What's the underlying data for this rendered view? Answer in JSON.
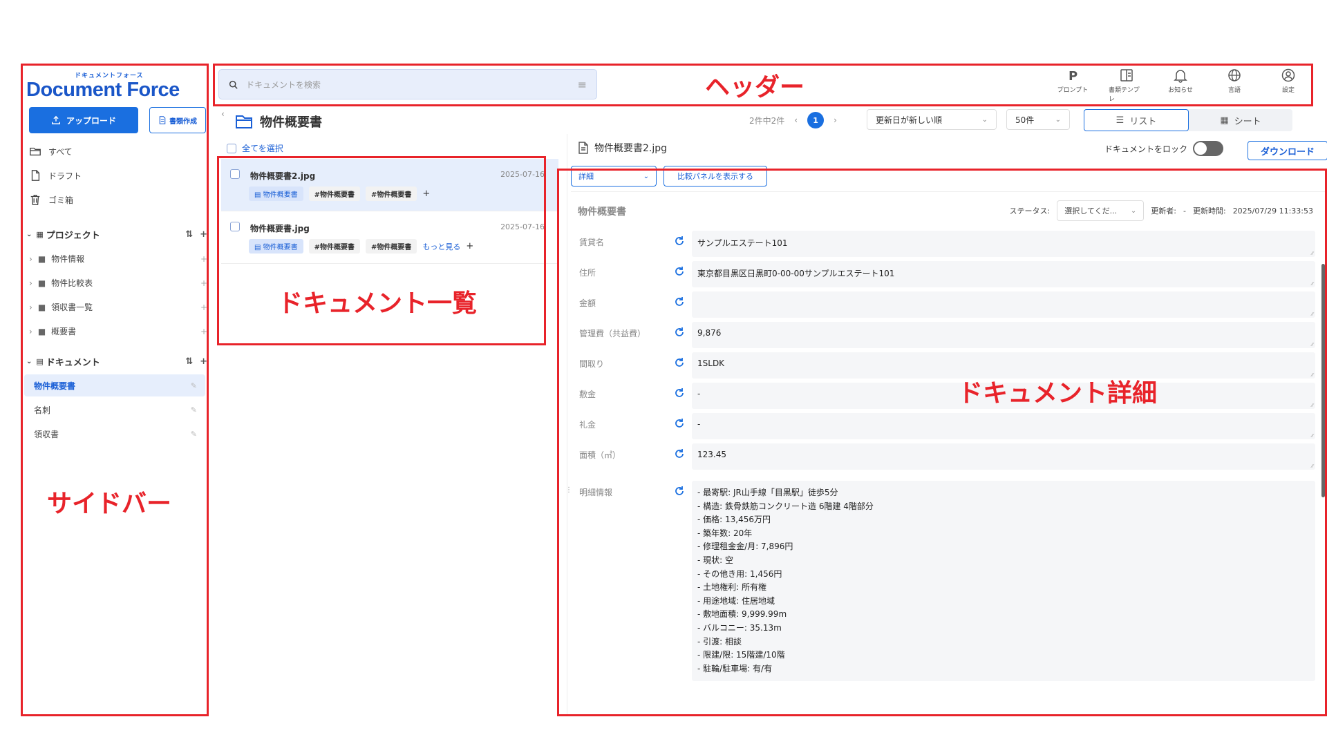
{
  "sidebar": {
    "logo_small": "ドキュメントフォース",
    "logo_main": "Document Force",
    "upload_label": "アップロード",
    "create_label": "書類作成",
    "nav": [
      {
        "label": "すべて",
        "icon": "folder-open-icon"
      },
      {
        "label": "ドラフト",
        "icon": "file-icon"
      },
      {
        "label": "ゴミ箱",
        "icon": "trash-icon"
      }
    ],
    "projects_header": "プロジェクト",
    "projects": [
      {
        "label": "物件情報"
      },
      {
        "label": "物件比較表"
      },
      {
        "label": "領収書一覧"
      },
      {
        "label": "概要書"
      }
    ],
    "documents_header": "ドキュメント",
    "documents": [
      {
        "label": "物件概要書",
        "active": true
      },
      {
        "label": "名刺",
        "active": false
      },
      {
        "label": "領収書",
        "active": false
      }
    ]
  },
  "header": {
    "search_placeholder": "ドキュメントを検索",
    "icons": [
      {
        "label": "プロンプト",
        "icon": "prompt-icon"
      },
      {
        "label": "書類テンプレ",
        "icon": "template-icon"
      },
      {
        "label": "お知らせ",
        "icon": "bell-icon"
      },
      {
        "label": "言語",
        "icon": "globe-icon"
      },
      {
        "label": "設定",
        "icon": "user-settings-icon"
      }
    ]
  },
  "list": {
    "title": "物件概要書",
    "select_all": "全てを選択",
    "count_text": "2件中2件",
    "page": "1",
    "sort": "更新日が新しい順",
    "per_page": "50件",
    "view_list": "リスト",
    "view_sheet": "シート",
    "docs": [
      {
        "name": "物件概要書2.jpg",
        "date": "2025-07-16",
        "tags": [
          "物件概要書",
          "#物件概要書",
          "#物件概要書"
        ],
        "more": "",
        "selected": true
      },
      {
        "name": "物件概要書.jpg",
        "date": "2025-07-16",
        "tags": [
          "物件概要書",
          "#物件概要書",
          "#物件概要書"
        ],
        "more": "もっと見る",
        "selected": false
      }
    ],
    "tag_plus": "+"
  },
  "detail": {
    "filename": "物件概要書2.jpg",
    "lock_label": "ドキュメントをロック",
    "download_label": "ダウンロード",
    "view_select": "詳細",
    "compare_label": "比較パネルを表示する",
    "form_title": "物件概要書",
    "status_label": "ステータス:",
    "status_value": "選択してくだ...",
    "updater_label": "更新者:",
    "updater_value": "-",
    "updated_time_label": "更新時間:",
    "updated_time_value": "2025/07/29 11:33:53",
    "fields": [
      {
        "label": "賃貸名",
        "value": "サンプルエステート101"
      },
      {
        "label": "住所",
        "value": "東京都目黒区日黒町0-00-00サンプルエステート101"
      },
      {
        "label": "金額",
        "value": ""
      },
      {
        "label": "管理費（共益費）",
        "value": "9,876"
      },
      {
        "label": "間取り",
        "value": "1SLDK"
      },
      {
        "label": "敷金",
        "value": "-"
      },
      {
        "label": "礼金",
        "value": "-"
      },
      {
        "label": "面積（㎡）",
        "value": "123.45"
      }
    ],
    "details_label": "明細情報",
    "details_lines": [
      "- 最寄駅: JR山手線「目黒駅」徒歩5分",
      "- 構造: 鉄骨鉄筋コンクリート造 6階建 4階部分",
      "- 価格: 13,456万円",
      "- 築年数: 20年",
      "- 修理租金金/月: 7,896円",
      "- 現状: 空",
      "- その他き用: 1,456円",
      "- 土地権利: 所有権",
      "- 用途地域: 住居地域",
      "- 敷地面積: 9,999.99m",
      "- バルコニー: 35.13m",
      "- 引渡: 相談",
      "- 限建/限: 15階建/10階",
      "- 駐輪/駐車場: 有/有"
    ]
  },
  "annotations": {
    "header": "ヘッダー",
    "sidebar": "サイドバー",
    "list": "ドキュメント一覧",
    "detail": "ドキュメント詳細"
  },
  "colors": {
    "accent": "#1a6fe0",
    "annotation": "#e8232a",
    "selected_bg": "#e6eefc"
  }
}
